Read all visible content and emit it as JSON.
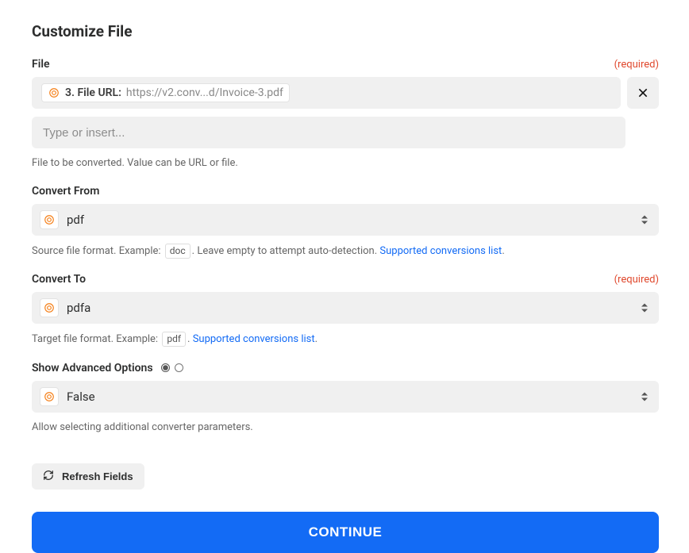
{
  "title": "Customize File",
  "required_tag": "(required)",
  "file": {
    "label": "File",
    "pill_prefix": "3. File URL:",
    "pill_value": "https://v2.conv...d/Invoice-3.pdf",
    "placeholder": "Type or insert...",
    "help": "File to be converted. Value can be URL or file."
  },
  "convert_from": {
    "label": "Convert From",
    "value": "pdf",
    "help_prefix": "Source file format. Example:",
    "code": "doc",
    "help_suffix": ". Leave empty to attempt auto-detection.",
    "link": "Supported conversions list"
  },
  "convert_to": {
    "label": "Convert To",
    "value": "pdfa",
    "help_prefix": "Target file format. Example:",
    "code": "pdf",
    "help_suffix": ".",
    "link": "Supported conversions list"
  },
  "advanced": {
    "label": "Show Advanced Options",
    "value": "False",
    "help": "Allow selecting additional converter parameters."
  },
  "buttons": {
    "refresh": "Refresh Fields",
    "continue": "CONTINUE"
  }
}
